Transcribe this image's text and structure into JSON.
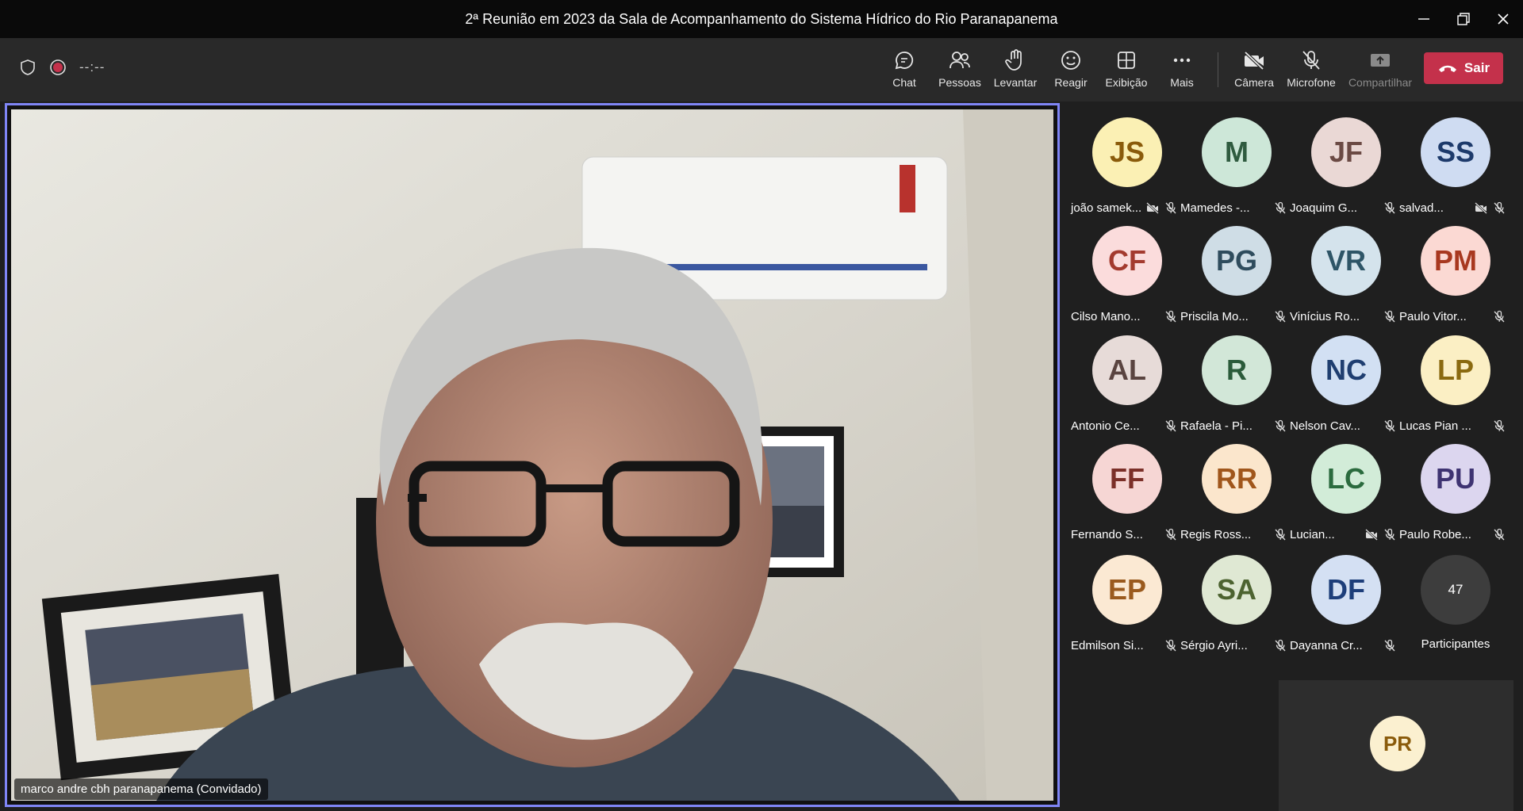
{
  "window": {
    "title": "2ª Reunião em 2023 da Sala de Acompanhamento do Sistema Hídrico do Rio Paranapanema"
  },
  "toolbar": {
    "timer": "--:--",
    "buttons": [
      {
        "label": "Chat",
        "icon": "chat-icon"
      },
      {
        "label": "Pessoas",
        "icon": "people-icon"
      },
      {
        "label": "Levantar",
        "icon": "raise-hand-icon"
      },
      {
        "label": "Reagir",
        "icon": "smiley-icon"
      },
      {
        "label": "Exibição",
        "icon": "view-grid-icon"
      },
      {
        "label": "Mais",
        "icon": "more-icon"
      },
      {
        "label": "Câmera",
        "icon": "camera-off-icon"
      },
      {
        "label": "Microfone",
        "icon": "mic-off-icon"
      },
      {
        "label": "Compartilhar",
        "icon": "share-icon"
      }
    ],
    "leave_label": "Sair"
  },
  "main_video": {
    "name_tag": "marco andre cbh paranapanema (Convidado)"
  },
  "participants": [
    {
      "initials": "JS",
      "name": "joão samek...",
      "bg": "#fbf0b4",
      "fg": "#8a5b0b",
      "cam_off": true
    },
    {
      "initials": "M",
      "name": "Mamedes -...",
      "bg": "#cde7d8",
      "fg": "#2f5b3f",
      "cam_off": false
    },
    {
      "initials": "JF",
      "name": "Joaquim G...",
      "bg": "#ead8d5",
      "fg": "#6b4a44",
      "cam_off": false
    },
    {
      "initials": "SS",
      "name": "salvad...",
      "bg": "#cfdcf2",
      "fg": "#1d3a6b",
      "cam_off": true
    },
    {
      "initials": "CF",
      "name": "Cilso Mano...",
      "bg": "#fbdcdc",
      "fg": "#a33a2e",
      "cam_off": false
    },
    {
      "initials": "PG",
      "name": "Priscila Mo...",
      "bg": "#cfdde6",
      "fg": "#2f4c5d",
      "cam_off": false
    },
    {
      "initials": "VR",
      "name": "Vinícius Ro...",
      "bg": "#d4e3ec",
      "fg": "#2e5567",
      "cam_off": false
    },
    {
      "initials": "PM",
      "name": "Paulo Vitor...",
      "bg": "#fbd9d3",
      "fg": "#a8381f",
      "cam_off": false
    },
    {
      "initials": "AL",
      "name": "Antonio Ce...",
      "bg": "#e7dbd8",
      "fg": "#5a4440",
      "cam_off": false
    },
    {
      "initials": "R",
      "name": "Rafaela - Pi...",
      "bg": "#d2e7d8",
      "fg": "#2b5b3a",
      "cam_off": false
    },
    {
      "initials": "NC",
      "name": "Nelson Cav...",
      "bg": "#d2e0f3",
      "fg": "#1f3e70",
      "cam_off": false
    },
    {
      "initials": "LP",
      "name": "Lucas Pian ...",
      "bg": "#fbefc4",
      "fg": "#8a6a10",
      "cam_off": false
    },
    {
      "initials": "FF",
      "name": "Fernando S...",
      "bg": "#f6d6d4",
      "fg": "#7b2f28",
      "cam_off": false
    },
    {
      "initials": "RR",
      "name": "Regis Ross...",
      "bg": "#fbe6cc",
      "fg": "#a0561b",
      "cam_off": false
    },
    {
      "initials": "LC",
      "name": "Lucian...",
      "bg": "#d2ecd8",
      "fg": "#2b6b3e",
      "cam_off": true
    },
    {
      "initials": "PU",
      "name": "Paulo Robe...",
      "bg": "#dcd6ef",
      "fg": "#3e3372",
      "cam_off": false
    },
    {
      "initials": "EP",
      "name": "Edmilson Si...",
      "bg": "#fbe9d3",
      "fg": "#9a5a1e",
      "cam_off": false
    },
    {
      "initials": "SA",
      "name": "Sérgio Ayri...",
      "bg": "#dfe8d3",
      "fg": "#4d6330",
      "cam_off": false
    },
    {
      "initials": "DF",
      "name": "Dayanna Cr...",
      "bg": "#d4e0f3",
      "fg": "#1d3e7a",
      "cam_off": false
    }
  ],
  "overflow": {
    "count": "47",
    "label": "Participantes"
  },
  "self_view": {
    "initials": "PR"
  }
}
